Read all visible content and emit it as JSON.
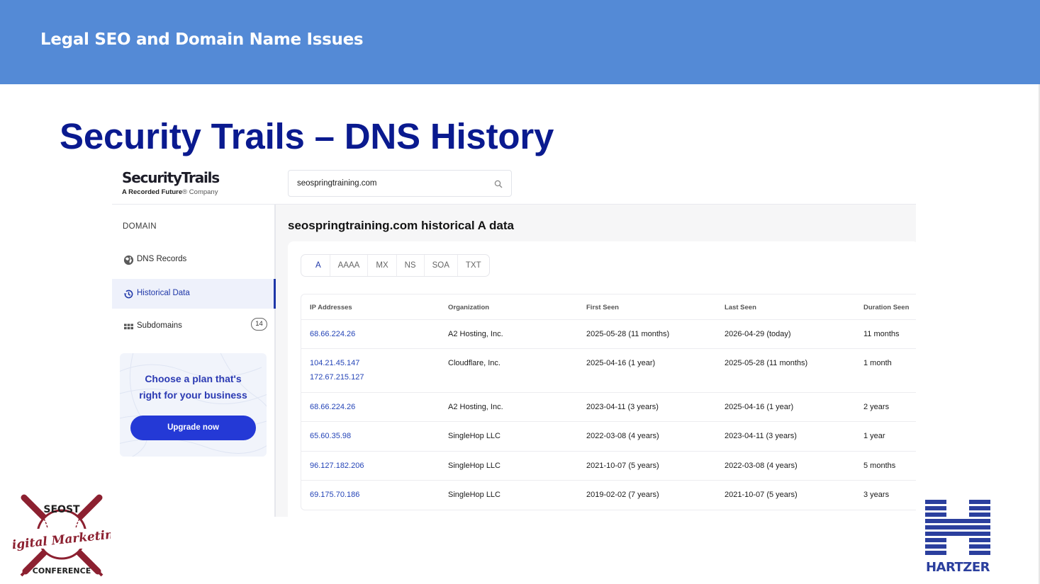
{
  "header": {
    "title": "Legal SEO and Domain Name Issues"
  },
  "slide": {
    "title": "Security Trails – DNS History"
  },
  "securitytrails": {
    "logo_name": "SecurityTrails",
    "logo_sub_brand": "A Recorded Future",
    "logo_sub_suffix": "® Company",
    "search": {
      "value": "seospringtraining.com",
      "icon": "search-icon"
    },
    "sidebar": {
      "heading": "DOMAIN",
      "items": [
        {
          "label": "DNS Records",
          "icon": "globe-icon"
        },
        {
          "label": "Historical Data",
          "icon": "history-icon",
          "active": true
        },
        {
          "label": "Subdomains",
          "icon": "grid-icon",
          "count": "14"
        }
      ],
      "promo": {
        "line1": "Choose a plan that's",
        "line2": "right for your business",
        "button": "Upgrade now"
      }
    },
    "content": {
      "title": "seospringtraining.com historical A data",
      "tabs": [
        "A",
        "AAAA",
        "MX",
        "NS",
        "SOA",
        "TXT"
      ],
      "active_tab": "A",
      "table": {
        "headers": [
          "IP Addresses",
          "Organization",
          "First Seen",
          "Last Seen",
          "Duration Seen"
        ],
        "rows": [
          {
            "ip1": "68.66.224.26",
            "ip2": "",
            "org": "A2 Hosting, Inc.",
            "first": "2025-05-28 (11 months)",
            "last": "2026-04-29 (today)",
            "duration": "11 months"
          },
          {
            "ip1": "104.21.45.147",
            "ip2": "172.67.215.127",
            "org": "Cloudflare, Inc.",
            "first": "2025-04-16 (1 year)",
            "last": "2025-05-28 (11 months)",
            "duration": "1 month"
          },
          {
            "ip1": "68.66.224.26",
            "ip2": "",
            "org": "A2 Hosting, Inc.",
            "first": "2023-04-11 (3 years)",
            "last": "2025-04-16 (1 year)",
            "duration": "2 years"
          },
          {
            "ip1": "65.60.35.98",
            "ip2": "",
            "org": "SingleHop LLC",
            "first": "2022-03-08 (4 years)",
            "last": "2023-04-11 (3 years)",
            "duration": "1 year"
          },
          {
            "ip1": "96.127.182.206",
            "ip2": "",
            "org": "SingleHop LLC",
            "first": "2021-10-07 (5 years)",
            "last": "2022-03-08 (4 years)",
            "duration": "5 months"
          },
          {
            "ip1": "69.175.70.186",
            "ip2": "",
            "org": "SingleHop LLC",
            "first": "2019-02-02 (7 years)",
            "last": "2021-10-07 (5 years)",
            "duration": "3 years"
          }
        ]
      }
    }
  },
  "logos": {
    "seost": {
      "top": "SEOST",
      "script": "Digital Marketing",
      "bottom": "CONFERENCE"
    },
    "hartzer": {
      "name": "HARTZER"
    }
  },
  "colors": {
    "header_bar": "#548ad6",
    "slide_title": "#0a1a8f",
    "accent_blue": "#2439d6",
    "link_blue": "#2444b7",
    "seost_red": "#8c2030",
    "hartzer_blue": "#2b3f9e"
  }
}
